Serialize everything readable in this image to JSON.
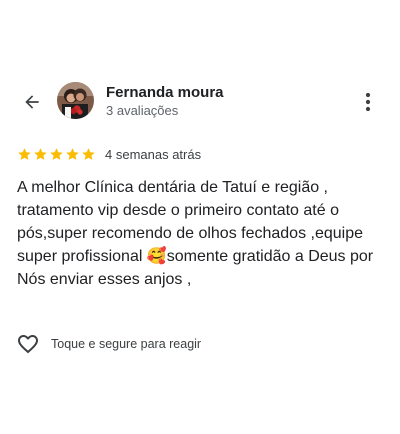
{
  "header": {
    "reviewer_name": "Fernanda moura",
    "reviewer_meta": "3 avaliações",
    "back_icon": "arrow-back-icon",
    "more_icon": "more-vert-icon"
  },
  "review": {
    "rating": 5,
    "rating_max": 5,
    "time_ago": "4 semanas atrás",
    "text": "A melhor Clínica dentária de Tatuí e região , tratamento vip desde o primeiro contato até o pós,super recomendo de olhos fechados ,equipe super profissional 🥰somente gratidão a Deus por Nós enviar esses anjos ,"
  },
  "reaction": {
    "label": "Toque e segure para reagir",
    "icon": "heart-outline-icon"
  },
  "colors": {
    "star": "#fbbc04",
    "text_primary": "#202124",
    "text_secondary": "#5f6368",
    "icon": "#3c4043"
  }
}
